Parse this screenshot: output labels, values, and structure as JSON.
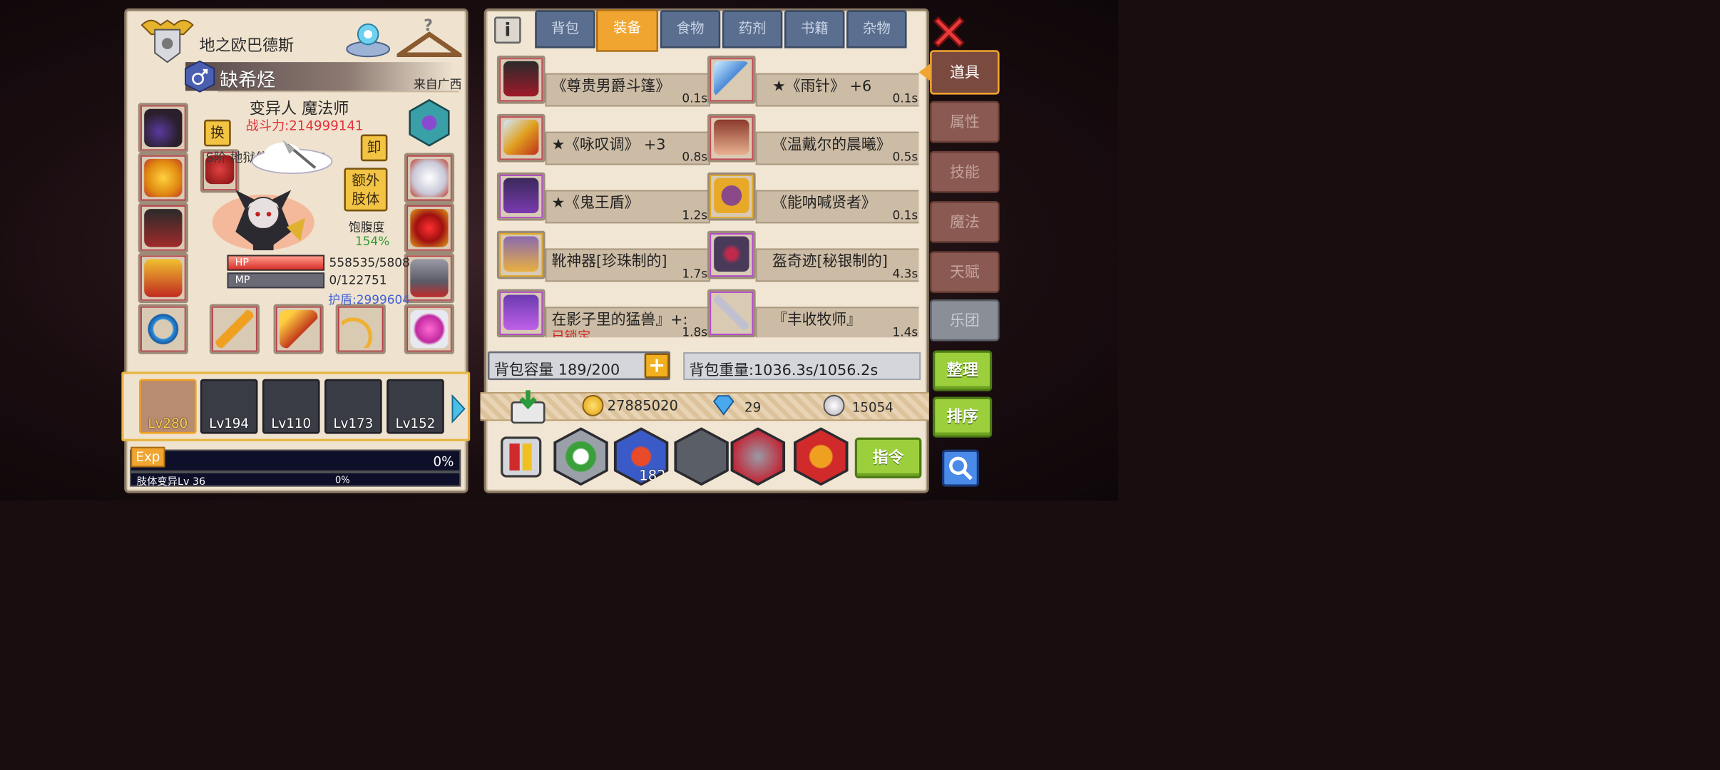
{
  "character": {
    "guild_title": "地之欧巴德斯",
    "name": "缺希烃",
    "origin": "来自广西",
    "race_class": "变异人 魔法师",
    "combat_power": "战斗力:214999141",
    "swap_label": "换",
    "unequip_label": "卸",
    "title_level": "S阶 地狱使徒 Lv 100",
    "extra_limb_label": "额外\n肢体",
    "satiety_label": "饱腹度",
    "satiety_value": "154%",
    "hp_label": "HP",
    "mp_label": "MP",
    "hp_value": "558535/5808",
    "mp_value": "0/122751",
    "shield": "护盾:2999604",
    "exp_label": "Exp",
    "exp_pct": "0%",
    "mutation_label": "肢体变异Lv 36",
    "mutation_pct": "0%"
  },
  "party": [
    {
      "lv": "Lv280"
    },
    {
      "lv": "Lv194"
    },
    {
      "lv": "Lv110"
    },
    {
      "lv": "Lv173"
    },
    {
      "lv": "Lv152"
    }
  ],
  "tabs": [
    "背包",
    "装备",
    "食物",
    "药剂",
    "书籍",
    "杂物"
  ],
  "active_tab": "装备",
  "items": [
    {
      "name": "《尊贵男爵斗篷》",
      "weight": "0.1s"
    },
    {
      "name": "★《雨针》 +6",
      "weight": "0.1s"
    },
    {
      "name": "★《咏叹调》 +3",
      "weight": "0.8s"
    },
    {
      "name": "《温戴尔的晨曦》",
      "weight": "0.5s"
    },
    {
      "name": "★《鬼王盾》",
      "weight": "1.2s"
    },
    {
      "name": "《能呐喊贤者》",
      "weight": "0.1s"
    },
    {
      "name": "靴神器[珍珠制的]",
      "weight": "1.7s"
    },
    {
      "name": "盔奇迹[秘银制的]",
      "weight": "4.3s"
    },
    {
      "name": "在影子里的猛兽』+:",
      "weight": "1.8s",
      "locked": "已锁定"
    },
    {
      "name": "『丰收牧师』",
      "weight": "1.4s"
    }
  ],
  "bag": {
    "capacity": "背包容量 189/200",
    "weight": "背包重量:1036.3s/1056.2s"
  },
  "currency": {
    "gold": "27885020",
    "gems": "29",
    "silver": "15054"
  },
  "potion_count": "182",
  "side_menu": [
    "道具",
    "属性",
    "技能",
    "魔法",
    "天赋",
    "乐团"
  ],
  "buttons": {
    "organize": "整理",
    "sort": "排序",
    "command": "指令"
  },
  "colors": {
    "accent": "#f0a530",
    "tab_blue": "#5a6f8f",
    "green_btn": "#9ccf3c",
    "hp": "#e8624f",
    "shield_text": "#3f5fd6"
  }
}
